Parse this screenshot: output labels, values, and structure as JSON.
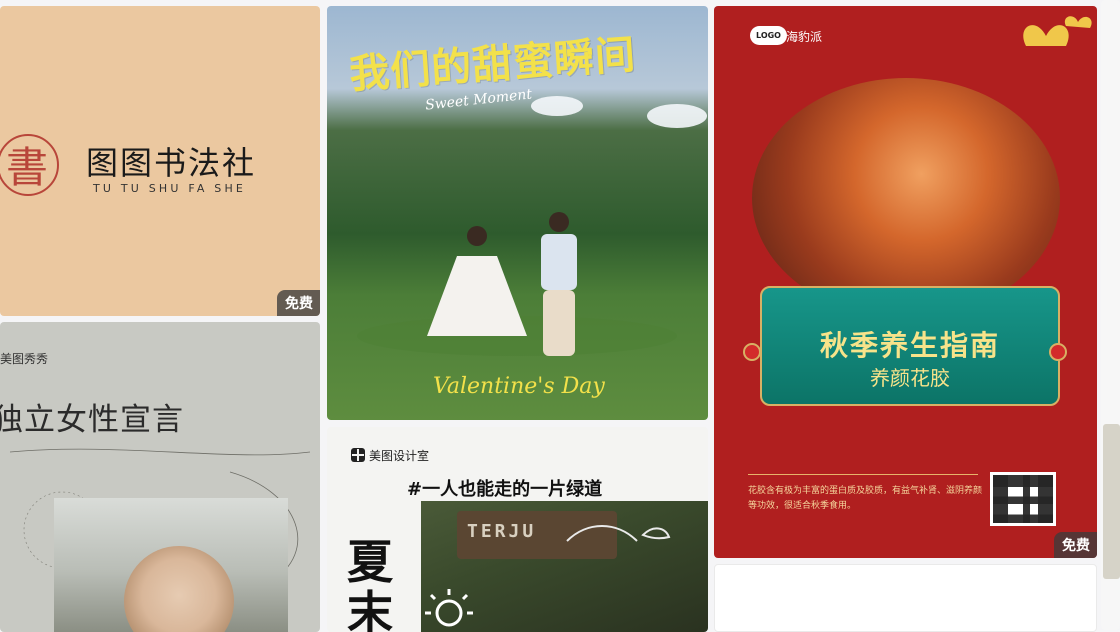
{
  "cards": [
    {
      "title": "图图书法社",
      "subtitle": "TU TU SHU FA SHE",
      "seal_glyph": "書",
      "badge": "免费"
    },
    {
      "brand": "美图秀秀",
      "headline": "独立女性宣言"
    },
    {
      "title": "我们的甜蜜瞬间",
      "script_sub": "Sweet Moment",
      "script_bottom": "Valentine's Day"
    },
    {
      "brand": "美图设计室",
      "tagline": "#一人也能走的一片绿道",
      "big_text_1": "夏",
      "big_text_2": "末",
      "sign_text": "TERJU"
    },
    {
      "logo": "LOGO",
      "brand": "海豹派",
      "title": "秋季养生指南",
      "subtitle": "养颜花胶",
      "description": "花胶含有极为丰富的蛋白质及胶质，有益气补肾、滋阴养颜等功效，很适合秋季食用。",
      "badge": "免费"
    }
  ]
}
